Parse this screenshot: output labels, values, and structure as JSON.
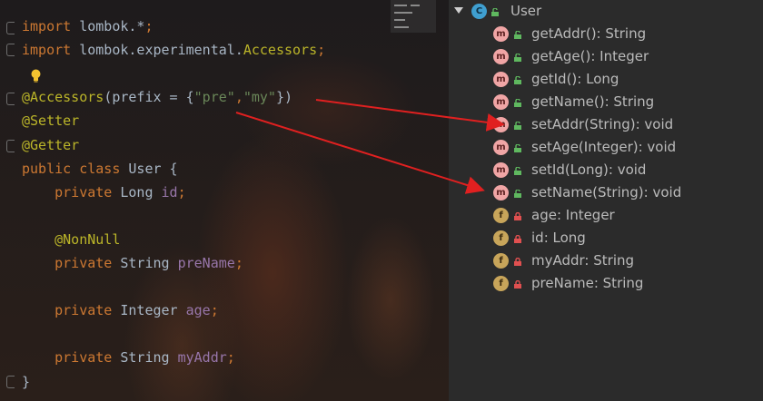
{
  "editor": {
    "lines": [
      {
        "parts": [
          {
            "t": "import",
            "c": "kw"
          },
          {
            "t": " lombok.*",
            "c": "plain"
          },
          {
            "t": ";",
            "c": "kw"
          }
        ]
      },
      {
        "parts": [
          {
            "t": "import",
            "c": "kw"
          },
          {
            "t": " lombok.experimental.",
            "c": "plain"
          },
          {
            "t": "Accessors",
            "c": "ann"
          },
          {
            "t": ";",
            "c": "kw"
          }
        ]
      },
      {
        "parts": []
      },
      {
        "parts": [
          {
            "t": "@Accessors",
            "c": "ann"
          },
          {
            "t": "(prefix = {",
            "c": "plain"
          },
          {
            "t": "\"pre\"",
            "c": "str"
          },
          {
            "t": ",",
            "c": "kw"
          },
          {
            "t": "\"my\"",
            "c": "str"
          },
          {
            "t": "})",
            "c": "plain"
          }
        ]
      },
      {
        "parts": [
          {
            "t": "@Setter",
            "c": "ann"
          }
        ]
      },
      {
        "parts": [
          {
            "t": "@Getter",
            "c": "ann"
          }
        ]
      },
      {
        "parts": [
          {
            "t": "public class ",
            "c": "kw"
          },
          {
            "t": "User {",
            "c": "plain"
          }
        ]
      },
      {
        "parts": [
          {
            "t": "    private ",
            "c": "kw"
          },
          {
            "t": "Long ",
            "c": "plain"
          },
          {
            "t": "id",
            "c": "field"
          },
          {
            "t": ";",
            "c": "kw"
          }
        ]
      },
      {
        "parts": []
      },
      {
        "parts": [
          {
            "t": "    @NonNull",
            "c": "ann"
          }
        ]
      },
      {
        "parts": [
          {
            "t": "    private ",
            "c": "kw"
          },
          {
            "t": "String ",
            "c": "plain"
          },
          {
            "t": "preName",
            "c": "field"
          },
          {
            "t": ";",
            "c": "kw"
          }
        ]
      },
      {
        "parts": []
      },
      {
        "parts": [
          {
            "t": "    private ",
            "c": "kw"
          },
          {
            "t": "Integer ",
            "c": "plain"
          },
          {
            "t": "age",
            "c": "field"
          },
          {
            "t": ";",
            "c": "kw"
          }
        ]
      },
      {
        "parts": []
      },
      {
        "parts": [
          {
            "t": "    private ",
            "c": "kw"
          },
          {
            "t": "String ",
            "c": "plain"
          },
          {
            "t": "myAddr",
            "c": "field"
          },
          {
            "t": ";",
            "c": "kw"
          }
        ]
      },
      {
        "parts": [
          {
            "t": "}",
            "c": "plain"
          }
        ]
      }
    ]
  },
  "structure": {
    "root": {
      "badge": "C",
      "label": "User"
    },
    "members": [
      {
        "kind": "m",
        "badge": "m",
        "label": "getAddr(): String"
      },
      {
        "kind": "m",
        "badge": "m",
        "label": "getAge(): Integer"
      },
      {
        "kind": "m",
        "badge": "m",
        "label": "getId(): Long"
      },
      {
        "kind": "m",
        "badge": "m",
        "label": "getName(): String"
      },
      {
        "kind": "m",
        "badge": "m",
        "label": "setAddr(String): void"
      },
      {
        "kind": "m",
        "badge": "m",
        "label": "setAge(Integer): void"
      },
      {
        "kind": "m",
        "badge": "m",
        "label": "setId(Long): void"
      },
      {
        "kind": "m",
        "badge": "m",
        "label": "setName(String): void"
      },
      {
        "kind": "f",
        "badge": "f",
        "label": "age: Integer"
      },
      {
        "kind": "f",
        "badge": "f",
        "label": "id: Long"
      },
      {
        "kind": "f",
        "badge": "f",
        "label": "myAddr: String"
      },
      {
        "kind": "f",
        "badge": "f",
        "label": "preName: String"
      }
    ]
  },
  "colors": {
    "arrow": "#e02020",
    "public_lock": "#5fb85f",
    "private_lock": "#e05050"
  }
}
